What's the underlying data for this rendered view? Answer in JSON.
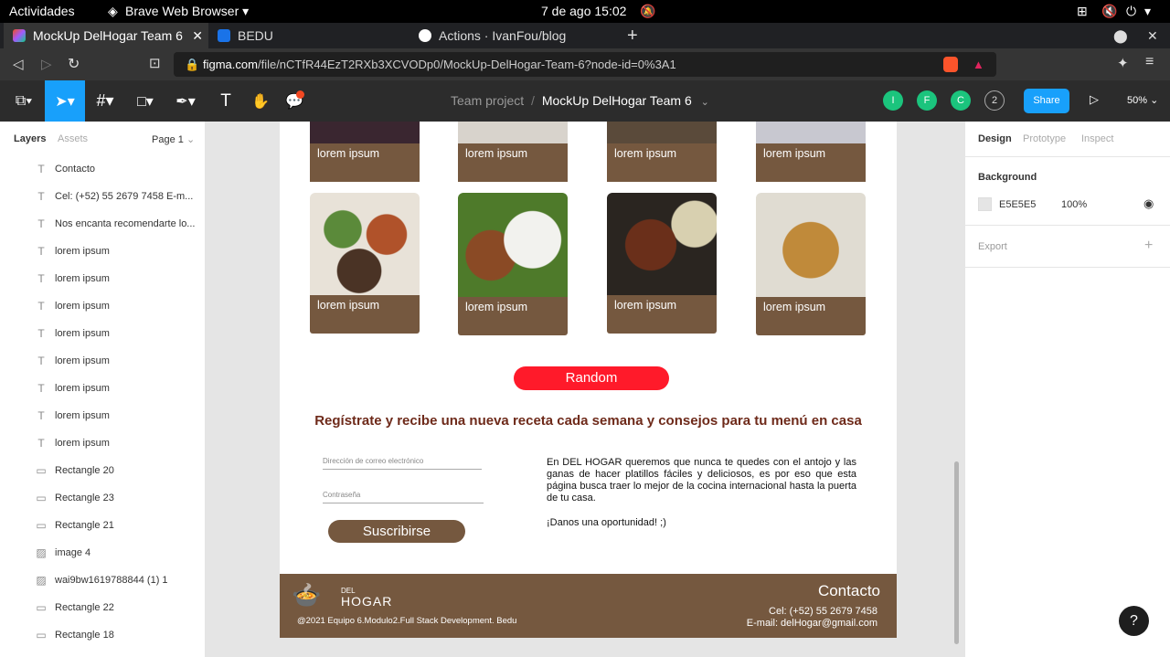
{
  "os": {
    "activities": "Actividades",
    "browser": "Brave Web Browser",
    "clock": "7 de ago  15:02"
  },
  "tabs": [
    {
      "label": "MockUp DelHogar Team 6"
    },
    {
      "label": "BEDU"
    },
    {
      "label": "Actions · IvanFou/blog"
    }
  ],
  "url": {
    "host": "figma.com",
    "path": "/file/nCTfR44EzT2RXb3XCVODp0/MockUp-DelHogar-Team-6?node-id=0%3A1"
  },
  "toolbar": {
    "project": "Team project",
    "separator": "/",
    "file": "MockUp DelHogar Team 6",
    "avatars": [
      "I",
      "F",
      "C"
    ],
    "avatar_count": "2",
    "share": "Share",
    "zoom": "50%"
  },
  "left": {
    "tabs": [
      "Layers",
      "Assets"
    ],
    "page": "Page 1",
    "layers": [
      {
        "icon": "T",
        "name": "Contacto"
      },
      {
        "icon": "T",
        "name": "Cel: (+52) 55 2679 7458 E-m..."
      },
      {
        "icon": "T",
        "name": "Nos encanta recomendarte lo..."
      },
      {
        "icon": "T",
        "name": "lorem ipsum"
      },
      {
        "icon": "T",
        "name": "lorem ipsum"
      },
      {
        "icon": "T",
        "name": "lorem ipsum"
      },
      {
        "icon": "T",
        "name": "lorem ipsum"
      },
      {
        "icon": "T",
        "name": "lorem ipsum"
      },
      {
        "icon": "T",
        "name": "lorem ipsum"
      },
      {
        "icon": "T",
        "name": "lorem ipsum"
      },
      {
        "icon": "T",
        "name": "lorem ipsum"
      },
      {
        "icon": "rect",
        "name": "Rectangle 20"
      },
      {
        "icon": "rect",
        "name": "Rectangle 23"
      },
      {
        "icon": "rect",
        "name": "Rectangle 21"
      },
      {
        "icon": "img",
        "name": "image 4"
      },
      {
        "icon": "img",
        "name": "wai9bw1619788844 (1) 1"
      },
      {
        "icon": "rect",
        "name": "Rectangle 22"
      },
      {
        "icon": "rect",
        "name": "Rectangle 18"
      }
    ]
  },
  "right": {
    "tabs": [
      "Design",
      "Prototype",
      "Inspect"
    ],
    "background_label": "Background",
    "bg_hex": "E5E5E5",
    "bg_opacity": "100%",
    "export_label": "Export",
    "bg_color": "#e5e5e5"
  },
  "canvas": {
    "card_label": "lorem ipsum",
    "random": "Random",
    "headline": "Regístrate y recibe una nueva receta cada semana y consejos para tu menú en casa",
    "email_placeholder": "Dirección de correo electrónico",
    "password_placeholder": "Contraseña",
    "subscribe": "Suscribirse",
    "para1": "En DEL HOGAR queremos que nunca te quedes con el antojo y las ganas de hacer platillos fáciles y deliciosos, es por eso que esta página busca traer lo mejor de la cocina internacional hasta la puerta de tu casa.",
    "para2": "¡Danos una oportunidad! ;)",
    "footer_logo_small": "DEL",
    "footer_logo_big": "HOGAR",
    "footer_copy": "@2021  Equipo 6.Modulo2.Full Stack Development. Bedu",
    "contact_title": "Contacto",
    "contact_phone": "Cel: (+52) 55 2679 7458",
    "contact_email": "E-mail: delHogar@gmail.com",
    "brown": "#75583f",
    "red": "#ff1a2a"
  },
  "help": "?"
}
